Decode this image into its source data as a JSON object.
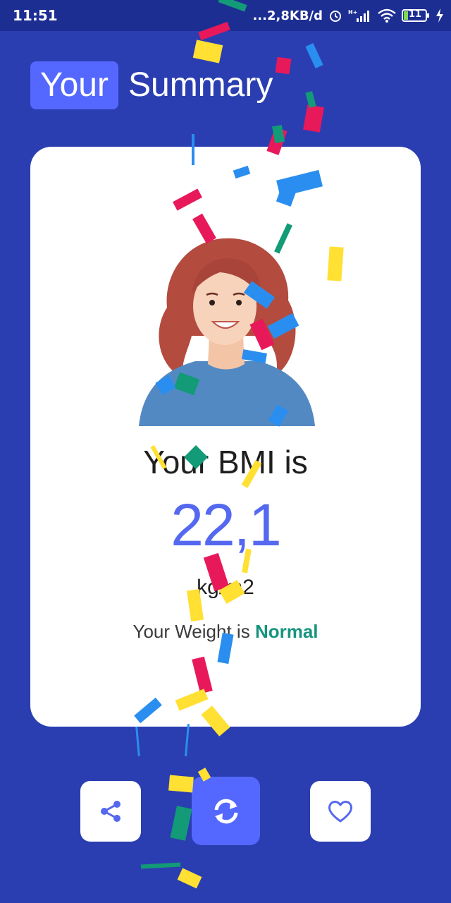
{
  "status_bar": {
    "time": "11:51",
    "network_speed": "...2,8KB/d",
    "battery": "11",
    "icons": [
      "alarm-icon",
      "signal-icon",
      "wifi-icon",
      "battery-icon",
      "charging-icon"
    ]
  },
  "header": {
    "title_highlight": "Your",
    "title_rest": "Summary"
  },
  "result": {
    "heading": "Your BMI is",
    "value": "22,1",
    "unit": "kg/m2",
    "weight_prefix": "Your Weight is",
    "weight_category": "Normal"
  },
  "actions": {
    "share_icon": "share-icon",
    "recalculate_icon": "refresh-icon",
    "favorite_icon": "heart-icon"
  },
  "colors": {
    "background": "#2a3eb1",
    "status_bar": "#1d2e93",
    "accent": "#5468ff",
    "bmi_value": "#5468f0",
    "normal_category": "#17947e"
  }
}
